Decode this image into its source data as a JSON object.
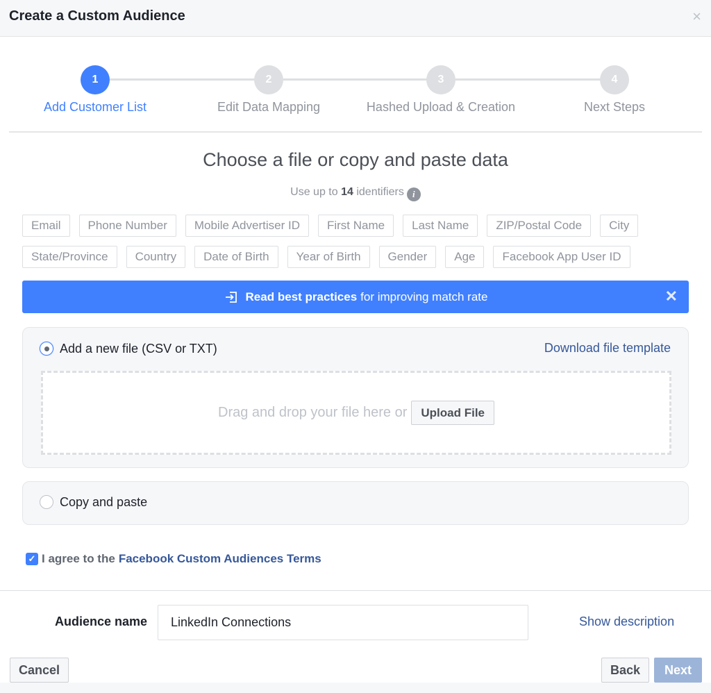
{
  "dialog": {
    "title": "Create a Custom Audience",
    "close_icon": "×"
  },
  "steps": [
    {
      "number": "1",
      "label": "Add Customer List",
      "active": true
    },
    {
      "number": "2",
      "label": "Edit Data Mapping",
      "active": false
    },
    {
      "number": "3",
      "label": "Hashed Upload & Creation",
      "active": false
    },
    {
      "number": "4",
      "label": "Next Steps",
      "active": false
    }
  ],
  "main": {
    "title": "Choose a file or copy and paste data",
    "subtitle_prefix": "Use up to",
    "identifier_count": "14",
    "subtitle_suffix": "identifiers",
    "info_icon": "i"
  },
  "identifiers": {
    "row1": [
      "Email",
      "Phone Number",
      "Mobile Advertiser ID",
      "First Name",
      "Last Name",
      "ZIP/Postal Code",
      "City"
    ],
    "row2": [
      "State/Province",
      "Country",
      "Date of Birth",
      "Year of Birth",
      "Gender",
      "Age",
      "Facebook App User ID"
    ]
  },
  "banner": {
    "link_text": "Read best practices",
    "text": "for improving match rate",
    "close_icon": "✕",
    "color": "#4080ff"
  },
  "file_option": {
    "label": "Add a new file (CSV or TXT)",
    "selected": true,
    "download_link": "Download file template",
    "drop_text": "Drag and drop your file here or",
    "upload_button": "Upload File"
  },
  "paste_option": {
    "label": "Copy and paste",
    "selected": false
  },
  "terms": {
    "checked": true,
    "check_icon": "✓",
    "prefix": "I agree to the",
    "link": "Facebook Custom Audiences Terms"
  },
  "footer": {
    "name_label": "Audience name",
    "name_value": "LinkedIn Connections",
    "show_description": "Show description",
    "cancel": "Cancel",
    "back": "Back",
    "next": "Next"
  }
}
